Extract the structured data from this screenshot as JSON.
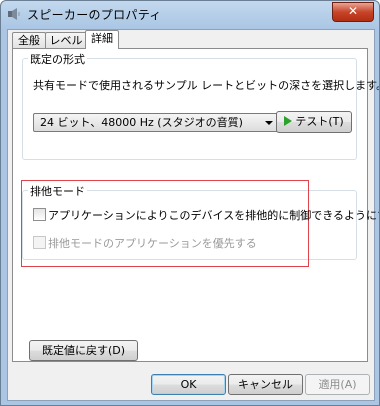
{
  "window": {
    "title": "スピーカーのプロパティ",
    "close_label": "✕"
  },
  "tabs": [
    {
      "label": "全般",
      "active": false
    },
    {
      "label": "レベル",
      "active": false
    },
    {
      "label": "詳細",
      "active": true
    }
  ],
  "default_format": {
    "legend": "既定の形式",
    "description": "共有モードで使用されるサンプル レートとビットの深さを選択します。",
    "selected_value": "24 ビット、48000 Hz (スタジオの音質)",
    "test_button": "テスト(T)"
  },
  "exclusive_mode": {
    "legend": "排他モード",
    "allow_exclusive_label": "アプリケーションによりこのデバイスを排他的に制御できるようにする",
    "allow_exclusive_checked": false,
    "priority_label": "排他モードのアプリケーションを優先する",
    "priority_checked": false,
    "priority_enabled": false
  },
  "restore_defaults_button": "既定値に戻す(D)",
  "footer": {
    "ok_label": "OK",
    "cancel_label": "キャンセル",
    "apply_label": "適用(A)"
  },
  "colors": {
    "highlight_box": "#e0444a",
    "test_play_icon": "#2ca12c"
  }
}
